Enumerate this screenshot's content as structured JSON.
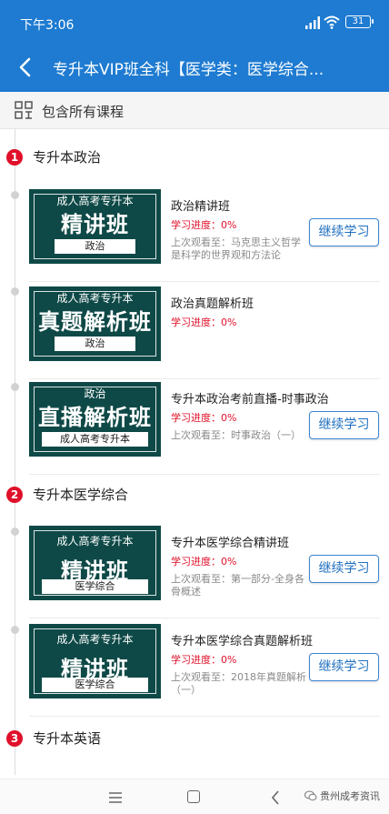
{
  "status_bar": {
    "time": "下午3:06",
    "battery": "31"
  },
  "nav": {
    "title": "专升本VIP班全科【医学类：医学综合..."
  },
  "contains": {
    "label": "包含所有课程"
  },
  "sections": [
    {
      "num": "1",
      "name": "专升本政治",
      "courses": [
        {
          "thumb_top": "成人高考专升本",
          "thumb_big": "精讲班",
          "thumb_tag": "政治",
          "title": "政治精讲班",
          "progress": "学习进度：0%",
          "last": "上次观看至：马克思主义哲学是科学的世界观和方法论",
          "button": "继续学习"
        },
        {
          "thumb_top": "成人高考专升本",
          "thumb_big": "真题解析班",
          "thumb_tag": "政治",
          "title": "政治真题解析班",
          "progress": "学习进度：0%",
          "last": "",
          "button": ""
        },
        {
          "thumb_top": "政治",
          "thumb_big": "直播解析班",
          "thumb_tag": "成人高考专升本",
          "title": "专升本政治考前直播-时事政治",
          "progress": "学习进度：0%",
          "last": "上次观看至：时事政治（一）",
          "button": "继续学习"
        }
      ]
    },
    {
      "num": "2",
      "name": "专升本医学综合",
      "courses": [
        {
          "thumb_top": "成人高考专升本",
          "thumb_big": "精讲班",
          "thumb_tag": "医学综合",
          "title": "专升本医学综合精讲班",
          "progress": "学习进度：0%",
          "last": "上次观看至：第一部分-全身各骨概述",
          "button": "继续学习"
        },
        {
          "thumb_top": "成人高考专升本",
          "thumb_big": "精讲班",
          "thumb_tag": "医学综合",
          "title": "专升本医学综合真题解析班",
          "progress": "学习进度：0%",
          "last": "上次观看至：2018年真题解析（一）",
          "button": "继续学习"
        }
      ]
    },
    {
      "num": "3",
      "name": "专升本英语",
      "courses": []
    }
  ],
  "watermark": "贵州成考资讯",
  "colors": {
    "header": "#1e7bd1",
    "progress": "#e0102a",
    "thumb": "#0e4947"
  }
}
